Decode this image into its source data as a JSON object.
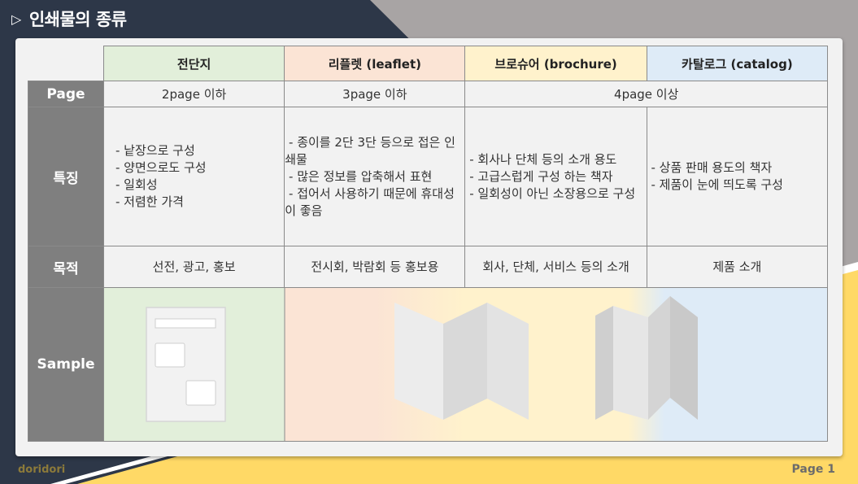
{
  "slide": {
    "title": "인쇄물의 종류",
    "title_icon": "play-triangle-outline-icon",
    "footer_left": "doridori",
    "footer_right": "Page 1"
  },
  "colors": {
    "dark_bg": "#2d3748",
    "gray_band": "#a8a4a4",
    "yellow_band": "#ffd966",
    "label_gray": "#7f7f7f",
    "col_green": "#e2efda",
    "col_peach": "#fbe4d5",
    "col_yellow": "#fff2cc",
    "col_blue": "#deebf7"
  },
  "table": {
    "columns": [
      {
        "label": "전단지",
        "color": "#e2efda"
      },
      {
        "label": "리플렛 (leaflet)",
        "color": "#fbe4d5"
      },
      {
        "label": "브로슈어 (brochure)",
        "color": "#fff2cc"
      },
      {
        "label": "카탈로그 (catalog)",
        "color": "#deebf7"
      }
    ],
    "row_labels": {
      "page": "Page",
      "features": "특징",
      "purpose": "목적",
      "sample": "Sample"
    },
    "page_row": [
      "2page 이하",
      "3page 이하",
      "4page 이상"
    ],
    "features_row": [
      "- 낱장으로 구성\n- 양면으로도 구성\n- 일회성\n- 저렴한 가격",
      " - 종이를 2단 3단 등으로 접은 인쇄물\n - 많은 정보를 압축해서 표현\n - 접어서 사용하기 때문에 휴대성이 좋음",
      " - 회사나 단체 등의 소개 용도\n - 고급스럽게 구성 하는 책자\n - 일회성이 아닌 소장용으로 구성",
      " - 상품 판매 용도의 책자\n - 제품이 눈에 띄도록 구성"
    ],
    "purpose_row": [
      "선전, 광고, 홍보",
      "전시회, 박람회 등 홍보용",
      "회사, 단체, 서비스 등의 소개",
      "제품 소개"
    ],
    "sample_icons": [
      "flyer-sheet-icon",
      "trifold-leaflet-icon",
      "folded-catalog-icon"
    ]
  }
}
